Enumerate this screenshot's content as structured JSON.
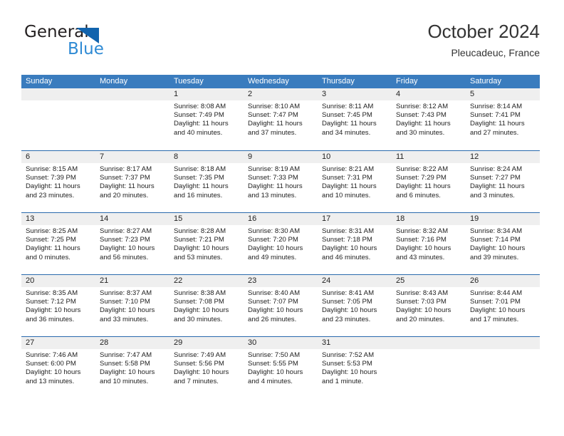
{
  "brand": {
    "name_part1": "General",
    "name_part2": "Blue",
    "triangle_color": "#1163ad",
    "blue_color": "#2e8ad4"
  },
  "header": {
    "title": "October 2024",
    "subtitle": "Pleucadeuc, France"
  },
  "theme": {
    "header_bar": "#3a7cbe",
    "row_border": "#2a6aad",
    "day_band": "#efefef",
    "text": "#222222"
  },
  "weekdays": [
    "Sunday",
    "Monday",
    "Tuesday",
    "Wednesday",
    "Thursday",
    "Friday",
    "Saturday"
  ],
  "weeks": [
    [
      {
        "day": "",
        "empty": true
      },
      {
        "day": "",
        "empty": true
      },
      {
        "day": "1",
        "sunrise": "Sunrise: 8:08 AM",
        "sunset": "Sunset: 7:49 PM",
        "daylight1": "Daylight: 11 hours",
        "daylight2": "and 40 minutes."
      },
      {
        "day": "2",
        "sunrise": "Sunrise: 8:10 AM",
        "sunset": "Sunset: 7:47 PM",
        "daylight1": "Daylight: 11 hours",
        "daylight2": "and 37 minutes."
      },
      {
        "day": "3",
        "sunrise": "Sunrise: 8:11 AM",
        "sunset": "Sunset: 7:45 PM",
        "daylight1": "Daylight: 11 hours",
        "daylight2": "and 34 minutes."
      },
      {
        "day": "4",
        "sunrise": "Sunrise: 8:12 AM",
        "sunset": "Sunset: 7:43 PM",
        "daylight1": "Daylight: 11 hours",
        "daylight2": "and 30 minutes."
      },
      {
        "day": "5",
        "sunrise": "Sunrise: 8:14 AM",
        "sunset": "Sunset: 7:41 PM",
        "daylight1": "Daylight: 11 hours",
        "daylight2": "and 27 minutes."
      }
    ],
    [
      {
        "day": "6",
        "sunrise": "Sunrise: 8:15 AM",
        "sunset": "Sunset: 7:39 PM",
        "daylight1": "Daylight: 11 hours",
        "daylight2": "and 23 minutes."
      },
      {
        "day": "7",
        "sunrise": "Sunrise: 8:17 AM",
        "sunset": "Sunset: 7:37 PM",
        "daylight1": "Daylight: 11 hours",
        "daylight2": "and 20 minutes."
      },
      {
        "day": "8",
        "sunrise": "Sunrise: 8:18 AM",
        "sunset": "Sunset: 7:35 PM",
        "daylight1": "Daylight: 11 hours",
        "daylight2": "and 16 minutes."
      },
      {
        "day": "9",
        "sunrise": "Sunrise: 8:19 AM",
        "sunset": "Sunset: 7:33 PM",
        "daylight1": "Daylight: 11 hours",
        "daylight2": "and 13 minutes."
      },
      {
        "day": "10",
        "sunrise": "Sunrise: 8:21 AM",
        "sunset": "Sunset: 7:31 PM",
        "daylight1": "Daylight: 11 hours",
        "daylight2": "and 10 minutes."
      },
      {
        "day": "11",
        "sunrise": "Sunrise: 8:22 AM",
        "sunset": "Sunset: 7:29 PM",
        "daylight1": "Daylight: 11 hours",
        "daylight2": "and 6 minutes."
      },
      {
        "day": "12",
        "sunrise": "Sunrise: 8:24 AM",
        "sunset": "Sunset: 7:27 PM",
        "daylight1": "Daylight: 11 hours",
        "daylight2": "and 3 minutes."
      }
    ],
    [
      {
        "day": "13",
        "sunrise": "Sunrise: 8:25 AM",
        "sunset": "Sunset: 7:25 PM",
        "daylight1": "Daylight: 11 hours",
        "daylight2": "and 0 minutes."
      },
      {
        "day": "14",
        "sunrise": "Sunrise: 8:27 AM",
        "sunset": "Sunset: 7:23 PM",
        "daylight1": "Daylight: 10 hours",
        "daylight2": "and 56 minutes."
      },
      {
        "day": "15",
        "sunrise": "Sunrise: 8:28 AM",
        "sunset": "Sunset: 7:21 PM",
        "daylight1": "Daylight: 10 hours",
        "daylight2": "and 53 minutes."
      },
      {
        "day": "16",
        "sunrise": "Sunrise: 8:30 AM",
        "sunset": "Sunset: 7:20 PM",
        "daylight1": "Daylight: 10 hours",
        "daylight2": "and 49 minutes."
      },
      {
        "day": "17",
        "sunrise": "Sunrise: 8:31 AM",
        "sunset": "Sunset: 7:18 PM",
        "daylight1": "Daylight: 10 hours",
        "daylight2": "and 46 minutes."
      },
      {
        "day": "18",
        "sunrise": "Sunrise: 8:32 AM",
        "sunset": "Sunset: 7:16 PM",
        "daylight1": "Daylight: 10 hours",
        "daylight2": "and 43 minutes."
      },
      {
        "day": "19",
        "sunrise": "Sunrise: 8:34 AM",
        "sunset": "Sunset: 7:14 PM",
        "daylight1": "Daylight: 10 hours",
        "daylight2": "and 39 minutes."
      }
    ],
    [
      {
        "day": "20",
        "sunrise": "Sunrise: 8:35 AM",
        "sunset": "Sunset: 7:12 PM",
        "daylight1": "Daylight: 10 hours",
        "daylight2": "and 36 minutes."
      },
      {
        "day": "21",
        "sunrise": "Sunrise: 8:37 AM",
        "sunset": "Sunset: 7:10 PM",
        "daylight1": "Daylight: 10 hours",
        "daylight2": "and 33 minutes."
      },
      {
        "day": "22",
        "sunrise": "Sunrise: 8:38 AM",
        "sunset": "Sunset: 7:08 PM",
        "daylight1": "Daylight: 10 hours",
        "daylight2": "and 30 minutes."
      },
      {
        "day": "23",
        "sunrise": "Sunrise: 8:40 AM",
        "sunset": "Sunset: 7:07 PM",
        "daylight1": "Daylight: 10 hours",
        "daylight2": "and 26 minutes."
      },
      {
        "day": "24",
        "sunrise": "Sunrise: 8:41 AM",
        "sunset": "Sunset: 7:05 PM",
        "daylight1": "Daylight: 10 hours",
        "daylight2": "and 23 minutes."
      },
      {
        "day": "25",
        "sunrise": "Sunrise: 8:43 AM",
        "sunset": "Sunset: 7:03 PM",
        "daylight1": "Daylight: 10 hours",
        "daylight2": "and 20 minutes."
      },
      {
        "day": "26",
        "sunrise": "Sunrise: 8:44 AM",
        "sunset": "Sunset: 7:01 PM",
        "daylight1": "Daylight: 10 hours",
        "daylight2": "and 17 minutes."
      }
    ],
    [
      {
        "day": "27",
        "sunrise": "Sunrise: 7:46 AM",
        "sunset": "Sunset: 6:00 PM",
        "daylight1": "Daylight: 10 hours",
        "daylight2": "and 13 minutes."
      },
      {
        "day": "28",
        "sunrise": "Sunrise: 7:47 AM",
        "sunset": "Sunset: 5:58 PM",
        "daylight1": "Daylight: 10 hours",
        "daylight2": "and 10 minutes."
      },
      {
        "day": "29",
        "sunrise": "Sunrise: 7:49 AM",
        "sunset": "Sunset: 5:56 PM",
        "daylight1": "Daylight: 10 hours",
        "daylight2": "and 7 minutes."
      },
      {
        "day": "30",
        "sunrise": "Sunrise: 7:50 AM",
        "sunset": "Sunset: 5:55 PM",
        "daylight1": "Daylight: 10 hours",
        "daylight2": "and 4 minutes."
      },
      {
        "day": "31",
        "sunrise": "Sunrise: 7:52 AM",
        "sunset": "Sunset: 5:53 PM",
        "daylight1": "Daylight: 10 hours",
        "daylight2": "and 1 minute."
      },
      {
        "day": "",
        "empty": true
      },
      {
        "day": "",
        "empty": true
      }
    ]
  ]
}
